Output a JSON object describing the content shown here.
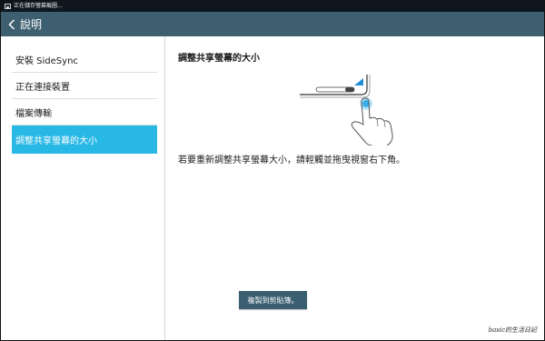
{
  "status_bar": {
    "notification_text": "正在儲存螢幕截圖..."
  },
  "action_bar": {
    "title": "說明"
  },
  "sidebar": {
    "items": [
      {
        "label": "安裝 SideSync",
        "selected": false
      },
      {
        "label": "正在連接裝置",
        "selected": false
      },
      {
        "label": "檔案傳輸",
        "selected": false
      },
      {
        "label": "調整共享螢幕的大小",
        "selected": true
      }
    ]
  },
  "detail": {
    "title": "調整共享螢幕的大小",
    "description": "若要重新調整共享螢幕大小，請輕觸並拖曳視窗右下角。",
    "copy_button_label": "複製到剪貼簿。"
  },
  "watermark": {
    "text": "basic的生活日記"
  },
  "colors": {
    "action_bar": "#3d5f70",
    "selected_item": "#27b8e6",
    "status_bar": "#0f161d",
    "button": "#3a5f71"
  },
  "icons": {
    "back": "chevron-left-icon",
    "status": "screenshot-icon",
    "illustration": "drag-resize-illustration"
  }
}
